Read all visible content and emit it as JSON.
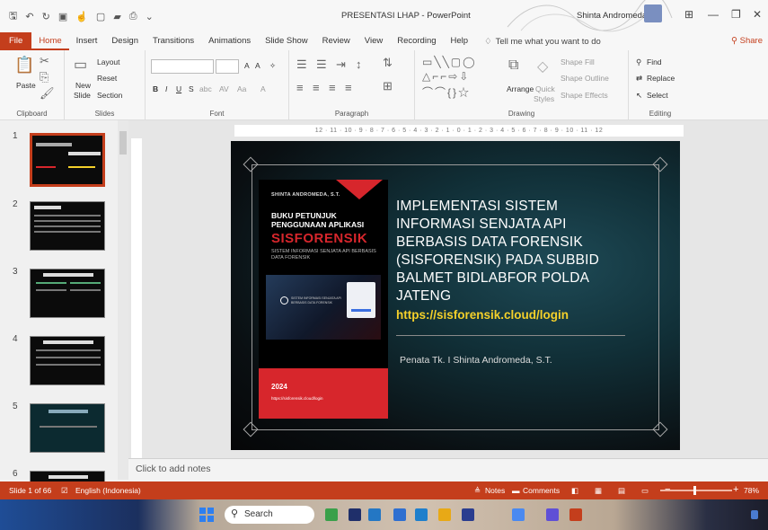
{
  "window": {
    "title": "PRESENTASI LHAP  -  PowerPoint",
    "user": "Shinta Andromeda",
    "controls": [
      "—",
      "❐",
      "✕"
    ]
  },
  "ribbon_tabs": [
    "Home",
    "Insert",
    "Design",
    "Transitions",
    "Animations",
    "Slide Show",
    "Review",
    "View",
    "Recording",
    "Help"
  ],
  "file_tab": "File",
  "tell_me": "Tell me what you want to do",
  "share": "Share",
  "ribbon": {
    "clipboard": {
      "paste": "Paste",
      "label": "Clipboard"
    },
    "slides": {
      "new_slide_1": "New",
      "new_slide_2": "Slide",
      "layout": "Layout",
      "reset": "Reset",
      "section": "Section",
      "label": "Slides"
    },
    "font": {
      "label": "Font",
      "font_size_up": "A",
      "font_size_down": "A"
    },
    "paragraph": {
      "label": "Paragraph"
    },
    "drawing": {
      "arrange": "Arrange",
      "quick_styles_1": "Quick",
      "quick_styles_2": "Styles",
      "shape_fill": "Shape Fill",
      "shape_outline": "Shape Outline",
      "shape_effects": "Shape Effects",
      "label": "Drawing"
    },
    "editing": {
      "find": "Find",
      "replace": "Replace",
      "select": "Select",
      "label": "Editing"
    }
  },
  "ruler": "12 · 11 · 10 · 9 · 8 · 7 · 6 · 5 · 4 · 3 · 2 · 1 · 0 · 1 · 2 · 3 · 4 · 5 · 6 · 7 · 8 · 9 · 10 · 11 · 12",
  "thumbnails": [
    "1",
    "2",
    "3",
    "4",
    "5",
    "6"
  ],
  "slide": {
    "book_author": "SHINTA ANDROMEDA, S.T.",
    "book_title": "BUKU PETUNJUK PENGGUNAAN APLIKASI",
    "book_brand": "SISFORENSIK",
    "book_subtitle": "SISTEM INFORMASI SENJATA API BERBASIS DATA FORENSIK",
    "book_shot_text": "SISTEM INFORMASI SENJATA API BERBASIS DATA FORENSIK",
    "book_year": "2024",
    "book_url": "https://sisforensik.cloud/login",
    "title": "IMPLEMENTASI SISTEM INFORMASI SENJATA API BERBASIS DATA FORENSIK (SISFORENSIK) PADA SUBBID BALMET BIDLABFOR POLDA JATENG",
    "url": "https://sisforensik.cloud/login",
    "presenter": "Penata Tk. I Shinta Andromeda, S.T."
  },
  "notes_placeholder": "Click to add notes",
  "statusbar": {
    "slide_count": "Slide 1 of 66",
    "language": "English (Indonesia)",
    "notes": "Notes",
    "comments": "Comments",
    "zoom": "78%"
  },
  "taskbar": {
    "search": "Search"
  }
}
